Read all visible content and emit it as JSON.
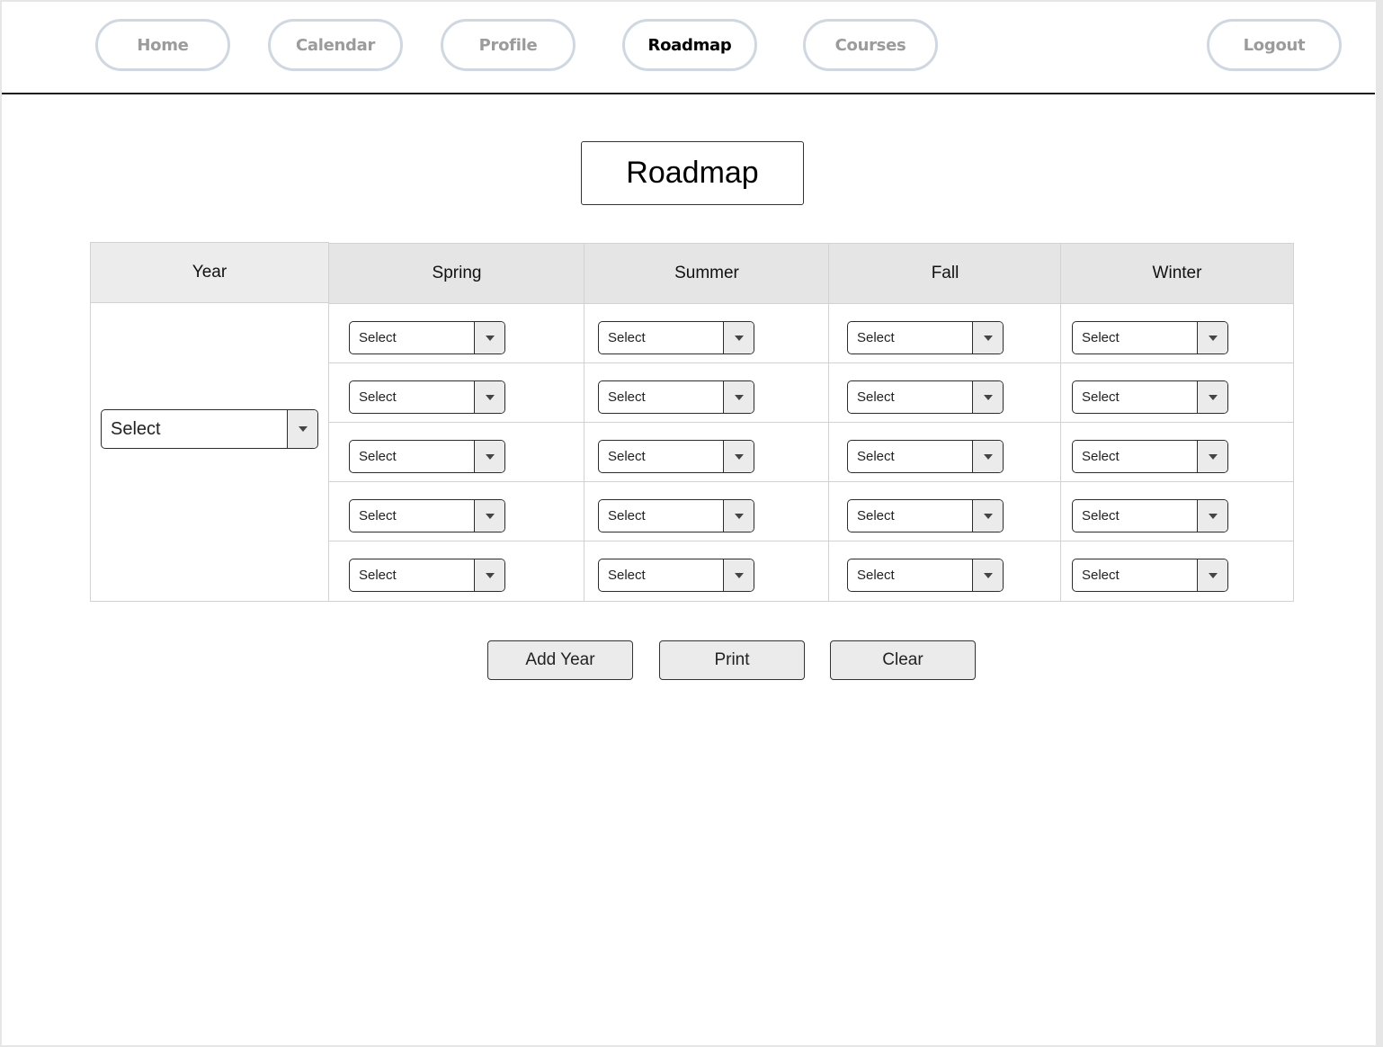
{
  "nav": {
    "items": [
      {
        "label": "Home",
        "active": false
      },
      {
        "label": "Calendar",
        "active": false
      },
      {
        "label": "Profile",
        "active": false
      },
      {
        "label": "Roadmap",
        "active": true
      },
      {
        "label": "Courses",
        "active": false
      }
    ],
    "logout_label": "Logout"
  },
  "page_title": "Roadmap",
  "table": {
    "headers": {
      "year": "Year",
      "seasons": [
        "Spring",
        "Summer",
        "Fall",
        "Winter"
      ]
    },
    "year_select": {
      "value": "Select"
    },
    "rows": [
      [
        "Select",
        "Select",
        "Select",
        "Select"
      ],
      [
        "Select",
        "Select",
        "Select",
        "Select"
      ],
      [
        "Select",
        "Select",
        "Select",
        "Select"
      ],
      [
        "Select",
        "Select",
        "Select",
        "Select"
      ],
      [
        "Select",
        "Select",
        "Select",
        "Select"
      ]
    ]
  },
  "actions": {
    "add_year": "Add Year",
    "print": "Print",
    "clear": "Clear"
  }
}
